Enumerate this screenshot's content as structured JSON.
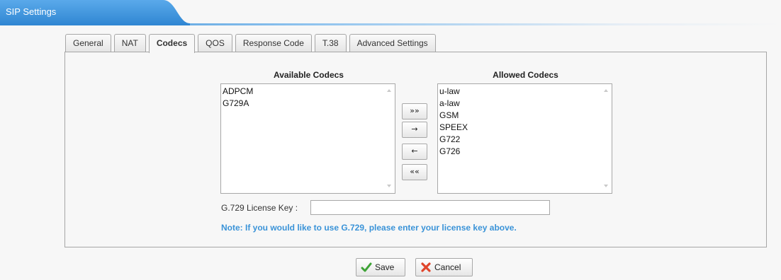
{
  "header": {
    "title": "SIP Settings"
  },
  "tabs": [
    {
      "label": "General",
      "active": false
    },
    {
      "label": "NAT",
      "active": false
    },
    {
      "label": "Codecs",
      "active": true
    },
    {
      "label": "QOS",
      "active": false
    },
    {
      "label": "Response Code",
      "active": false
    },
    {
      "label": "T.38",
      "active": false
    },
    {
      "label": "Advanced Settings",
      "active": false
    }
  ],
  "codecs": {
    "available_title": "Available Codecs",
    "allowed_title": "Allowed Codecs",
    "available": [
      "ADPCM",
      "G729A"
    ],
    "allowed": [
      "u-law",
      "a-law",
      "GSM",
      "SPEEX",
      "G722",
      "G726"
    ],
    "buttons": {
      "move_all_right": "»»",
      "move_right": "→",
      "move_left": "←",
      "move_all_left": "««"
    }
  },
  "license": {
    "label": "G.729 License Key :",
    "value": "",
    "note": "Note: If you would like to use G.729, please enter your license key above."
  },
  "actions": {
    "save": "Save",
    "cancel": "Cancel"
  },
  "colors": {
    "accent": "#3a8fd6",
    "note": "#3a93d8"
  },
  "icons": {
    "save": "check-icon",
    "cancel": "x-icon"
  }
}
